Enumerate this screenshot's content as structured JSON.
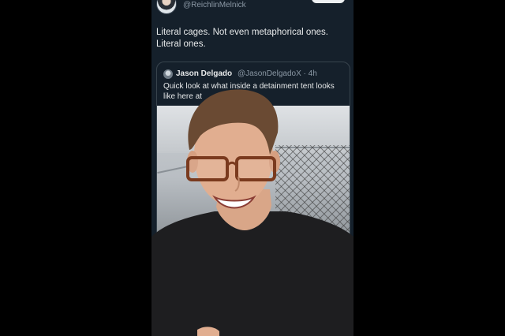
{
  "tweet": {
    "handle": "@ReichlinMelnick",
    "text_line1": "Literal cages. Not even metaphorical ones.",
    "text_line2": "Literal ones."
  },
  "quote": {
    "name": "Jason Delgado",
    "handle_time": "@JasonDelgadoX · 4h",
    "text_line1": "Quick look at what inside a detainment tent looks",
    "text_line2": "like here at"
  },
  "colors": {
    "background": "#15202b",
    "text": "#e7e9ea",
    "muted": "#8b98a5",
    "border": "#38444d"
  }
}
